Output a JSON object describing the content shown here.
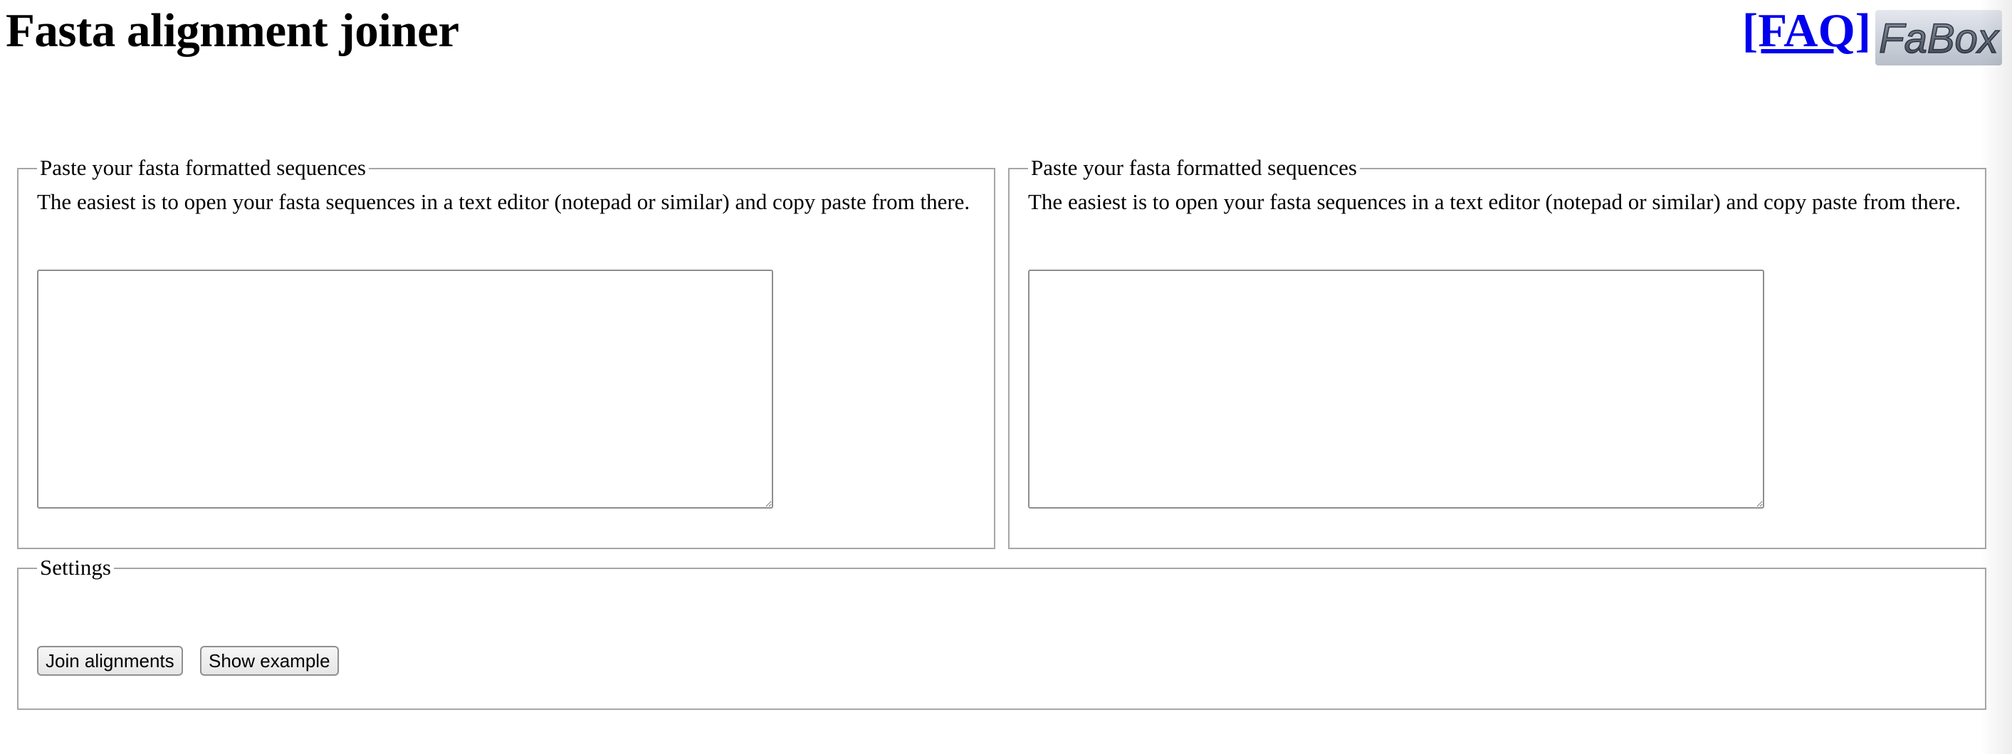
{
  "header": {
    "title": "Fasta alignment joiner",
    "faq_label": "[FAQ]",
    "logo_text": "FaBox"
  },
  "panels": [
    {
      "legend": "Paste your fasta formatted sequences",
      "help": "The easiest is to open your fasta sequences in a text editor (notepad or similar) and copy paste from there.",
      "value": ""
    },
    {
      "legend": "Paste your fasta formatted sequences",
      "help": "The easiest is to open your fasta sequences in a text editor (notepad or similar) and copy paste from there.",
      "value": ""
    }
  ],
  "settings": {
    "legend": "Settings",
    "join_label": "Join alignments",
    "example_label": "Show example"
  },
  "colors": {
    "link": "#0000ee",
    "border": "#a6a6a6"
  }
}
